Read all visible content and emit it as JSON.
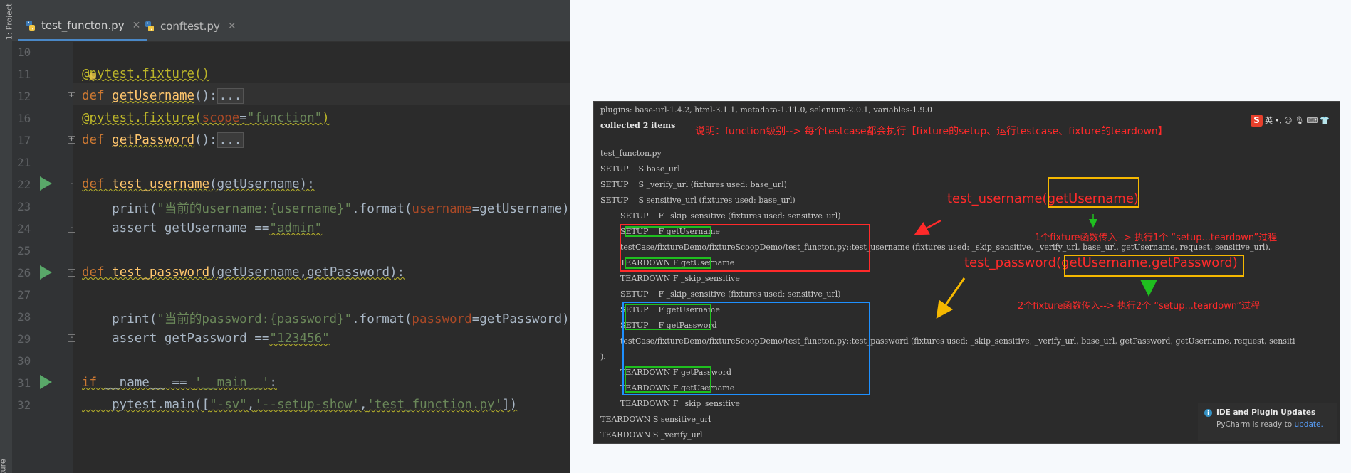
{
  "ide": {
    "sidebar_label": "1: Project",
    "sidebar_label_bottom": "ture",
    "tabs": [
      {
        "label": "test_functon.py",
        "active": true
      },
      {
        "label": "conftest.py",
        "active": false
      }
    ],
    "line_numbers": [
      "10",
      "11",
      "12",
      "16",
      "17",
      "21",
      "22",
      "23",
      "24",
      "25",
      "26",
      "27",
      "28",
      "29",
      "30",
      "31",
      "32"
    ],
    "code": {
      "l11": "@pytest.fixture()",
      "l12_kw": "def ",
      "l12_fn": "getUsername",
      "l12_rest": "():",
      "l12_fold": "...",
      "l16_dec": "@pytest.fixture(",
      "l16_par": "scope",
      "l16_eq": "=",
      "l16_str": "\"function\"",
      "l16_end": ")",
      "l17_kw": "def ",
      "l17_fn": "getPassword",
      "l17_rest": "():",
      "l17_fold": "...",
      "l22_kw": "def ",
      "l22_fn": "test_username",
      "l22_rest": "(getUsername):",
      "l23_a": "    print(",
      "l23_str": "\"当前的username:{username}\"",
      "l23_b": ".format(",
      "l23_par": "username",
      "l23_c": "=getUsername))",
      "l24_a": "    assert getUsername ==",
      "l24_str": "\"admin\"",
      "l26_kw": "def ",
      "l26_fn": "test_password",
      "l26_rest": "(getUsername,getPassword):",
      "l28_a": "    print(",
      "l28_str": "\"当前的password:{password}\"",
      "l28_b": ".format(",
      "l28_par": "password",
      "l28_c": "=getPassword))",
      "l29_a": "    assert getPassword ==",
      "l29_str": "\"123456\"",
      "l31_kw": "if",
      "l31_rest": " __name__ == ",
      "l31_str": "'__main__'",
      "l31_end": ":",
      "l32_a": "    pytest.main([",
      "l32_s1": "\"-sv\"",
      "l32_c": ",",
      "l32_s2": "'--setup-show'",
      "l32_c2": ",",
      "l32_s3": "'test_function.py'",
      "l32_end": "])"
    }
  },
  "terminal": {
    "plugins": "plugins: base-url-1.4.2, html-3.1.1, metadata-1.11.0, selenium-2.0.1, variables-1.9.0",
    "collected": "collected 2 items",
    "note": "说明：function级别--> 每个testcase都会执行【fixture的setup、运行testcase、fixture的teardown】",
    "file": "test_functon.py",
    "lines": [
      "SETUP    S base_url",
      "SETUP    S _verify_url (fixtures used: base_url)",
      "SETUP    S sensitive_url (fixtures used: base_url)",
      "        SETUP    F _skip_sensitive (fixtures used: sensitive_url)",
      "        SETUP    F getUsername",
      "        testCase/fixtureDemo/fixtureScoopDemo/test_functon.py::test_username (fixtures used: _skip_sensitive, _verify_url, base_url, getUsername, request, sensitive_url).",
      "        TEARDOWN F getUsername",
      "        TEARDOWN F _skip_sensitive",
      "        SETUP    F _skip_sensitive (fixtures used: sensitive_url)",
      "        SETUP    F getUsername",
      "        SETUP    F getPassword",
      "        testCase/fixtureDemo/fixtureScoopDemo/test_functon.py::test_password (fixtures used: _skip_sensitive, _verify_url, base_url, getPassword, getUsername, request, sensiti",
      ").",
      "        TEARDOWN F getPassword",
      "        TEARDOWN F getUsername",
      "        TEARDOWN F _skip_sensitive",
      "TEARDOWN S sensitive_url",
      "TEARDOWN S _verify_url"
    ],
    "ann1_prefix": "test_username(",
    "ann1_boxed": "getUsername)",
    "ann1_sub": "1个fixture函数传入--> 执行1个 “setup...teardown”过程",
    "ann2_prefix": "test_password(",
    "ann2_boxed": "getUsername,getPassword)",
    "ann2_sub": "2个fixture函数传入--> 执行2个 “setup...teardown”过程",
    "ime_label": "英",
    "ime_logo": "S"
  },
  "notification": {
    "title": "IDE and Plugin Updates",
    "text": "PyCharm is ready to ",
    "link": "update."
  },
  "colors": {
    "red": "#ff2a2a",
    "green": "#1fbf1f",
    "blue": "#1e90ff",
    "orange": "#f5b800"
  }
}
